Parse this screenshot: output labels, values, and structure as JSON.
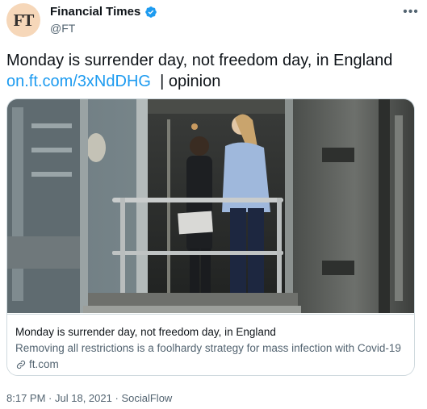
{
  "author": {
    "avatar_text": "FT",
    "name": "Financial Times",
    "handle": "@FT",
    "verified": true
  },
  "tweet": {
    "text_line1": "Monday is surrender day, not freedom day, in England",
    "link": "on.ft.com/3xNdDHG",
    "suffix": "| opinion"
  },
  "card": {
    "image_icon": "photo-two-people-glass-elevator",
    "title": "Monday is surrender day, not freedom day, in England",
    "description": "Removing all restrictions is a foolhardy strategy for mass infection with Covid-19",
    "domain": "ft.com",
    "domain_icon": "link-icon"
  },
  "meta": {
    "time": "8:17 PM",
    "separator1": "·",
    "date": "Jul 18, 2021",
    "separator2": "·",
    "source": "SocialFlow"
  },
  "icons": {
    "verified": "verified-badge-icon",
    "more": "more-options-icon"
  },
  "colors": {
    "link": "#1d9bf0",
    "text": "#0f1419",
    "muted": "#536471",
    "avatar_bg": "#f6d7b9",
    "border": "#cfd9de"
  }
}
